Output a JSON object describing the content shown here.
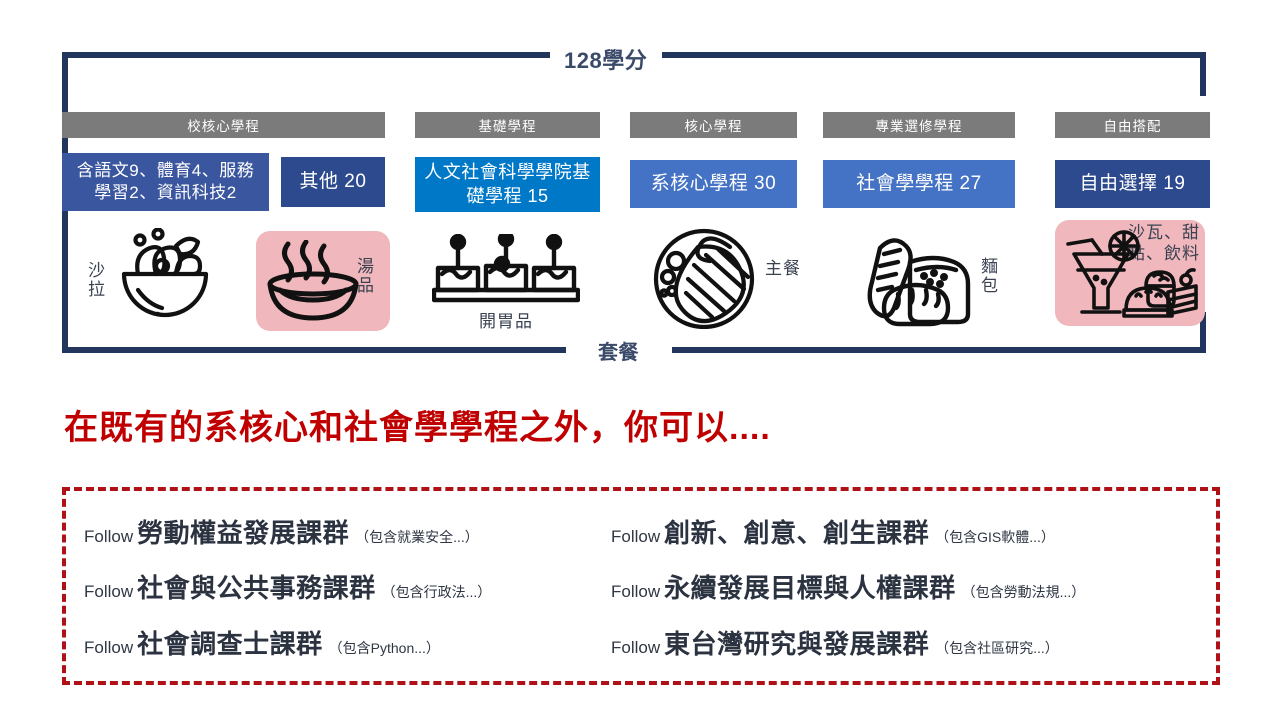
{
  "diagram": {
    "top_bracket_label": "128學分",
    "bottom_bracket_label": "套餐",
    "colors": {
      "navy_border": "#22355C",
      "gray_header": "#7B7B7B",
      "deep_blue": "#3A569E",
      "bright_blue": "#0078C8",
      "medium_blue": "#4472C4",
      "dark_navy_chip": "#2E4A8E",
      "pink": "#F0B8BC",
      "red_heading": "#C00000",
      "red_dashed": "#B01116"
    },
    "columns": [
      {
        "header": "校核心學程",
        "chips": [
          {
            "text": "含語文9、體育4、服務學習2、資訊科技2",
            "color": "#3A569E",
            "font_size": 17
          },
          {
            "text": "其他 20",
            "color": "#2E4A8E",
            "font_size": 19
          }
        ]
      },
      {
        "header": "基礎學程",
        "chips": [
          {
            "text": "人文社會科學學院基礎學程 15",
            "color": "#0078C8",
            "font_size": 18
          }
        ]
      },
      {
        "header": "核心學程",
        "chips": [
          {
            "text": "系核心學程 30",
            "color": "#4472C4",
            "font_size": 19
          }
        ]
      },
      {
        "header": "專業選修學程",
        "chips": [
          {
            "text": "社會學學程 27",
            "color": "#4472C4",
            "font_size": 19
          }
        ]
      },
      {
        "header": "自由搭配",
        "chips": [
          {
            "text": "自由選擇 19",
            "color": "#2E4A8E",
            "font_size": 19
          }
        ]
      }
    ],
    "food_items": [
      {
        "label": "沙拉",
        "icon": "salad-bowl-icon",
        "highlight": false
      },
      {
        "label": "湯品",
        "icon": "soup-bowl-icon",
        "highlight": true
      },
      {
        "label": "開胃品",
        "icon": "appetizer-icon",
        "highlight": false
      },
      {
        "label": "主餐",
        "icon": "main-dish-icon",
        "highlight": false
      },
      {
        "label": "麵包",
        "icon": "bread-icon",
        "highlight": false
      },
      {
        "label": "沙瓦、甜點、飲料",
        "icon": "dessert-drink-icon",
        "highlight": true
      }
    ]
  },
  "headline": "在既有的系核心和社會學學程之外，你可以....",
  "courses": {
    "follow_label": "Follow",
    "left": [
      {
        "name": "勞動權益發展課群",
        "note": "（包含就業安全...）"
      },
      {
        "name": "社會與公共事務課群",
        "note": "（包含行政法...）"
      },
      {
        "name": "社會調查士課群",
        "note": "（包含Python...）"
      }
    ],
    "right": [
      {
        "name": "創新、創意、創生課群",
        "note": "（包含GIS軟體...）"
      },
      {
        "name": "永續發展目標與人權課群",
        "note": "（包含勞動法規...）"
      },
      {
        "name": "東台灣研究與發展課群",
        "note": "（包含社區研究...）"
      }
    ]
  }
}
